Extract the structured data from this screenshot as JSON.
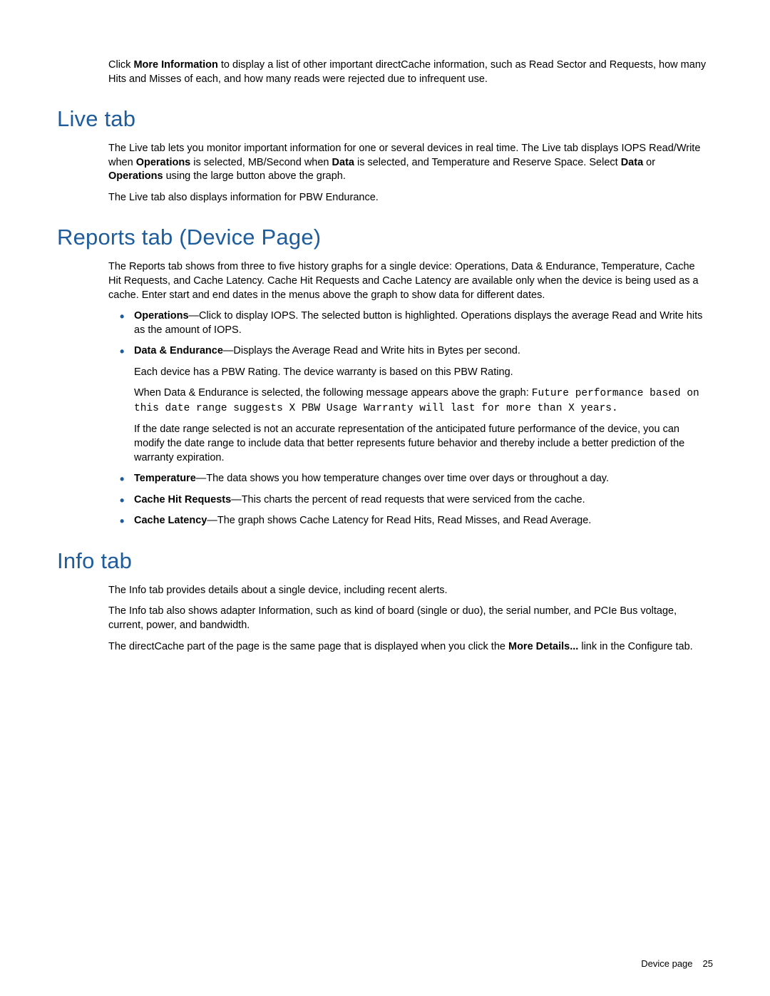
{
  "intro": {
    "p1a": "Click ",
    "p1_bold": "More Information",
    "p1b": " to display a list of other important directCache information, such as Read Sector and Requests, how many Hits and Misses of each, and how many reads were rejected due to infrequent use."
  },
  "live": {
    "heading": "Live tab",
    "p1a": "The Live tab lets you monitor important information for one or several devices in real time. The Live tab displays IOPS Read/Write when ",
    "p1_b1": "Operations",
    "p1b": " is selected, MB/Second when ",
    "p1_b2": "Data",
    "p1c": " is selected, and Temperature and Reserve Space. Select ",
    "p1_b3": "Data",
    "p1d": " or ",
    "p1_b4": "Operations",
    "p1e": " using the large button above the graph.",
    "p2": "The Live tab also displays information for PBW Endurance."
  },
  "reports": {
    "heading": "Reports tab (Device Page)",
    "p1": "The Reports tab shows from three to five history graphs for a single device: Operations, Data & Endurance, Temperature, Cache Hit Requests, and Cache Latency. Cache Hit Requests and Cache Latency are available only when the device is being used as a cache. Enter start and end dates in the menus above the graph to show data for different dates.",
    "items": [
      {
        "bold": "Operations",
        "text": "—Click to display IOPS. The selected button is highlighted. Operations displays the average Read and Write hits as the amount of IOPS."
      },
      {
        "bold": "Data & Endurance",
        "text": "—Displays the Average Read and Write hits in Bytes per second.",
        "sub1": "Each device has a PBW Rating. The device warranty is based on this PBW Rating.",
        "sub2a": "When Data & Endurance is selected, the following message appears above the graph: ",
        "sub2_mono": "Future performance based on this date range suggests X PBW Usage Warranty will last for more than X years.",
        "sub3": "If the date range selected is not an accurate representation of the anticipated future performance of the device, you can modify the date range to include data that better represents future behavior and thereby include a better prediction of the warranty expiration."
      },
      {
        "bold": "Temperature",
        "text": "—The data shows you how temperature changes over time over days or throughout a day."
      },
      {
        "bold": "Cache Hit Requests",
        "text": "—This charts the percent of read requests that were serviced from the cache."
      },
      {
        "bold": "Cache Latency",
        "text": "—The graph shows Cache Latency for Read Hits, Read Misses, and Read Average."
      }
    ]
  },
  "info": {
    "heading": "Info tab",
    "p1": "The Info tab provides details about a single device, including recent alerts.",
    "p2": "The Info tab also shows adapter Information, such as kind of board (single or duo), the serial number, and PCIe Bus voltage, current, power, and bandwidth.",
    "p3a": "The directCache part of the page is the same page that is displayed when you click the ",
    "p3_bold": "More Details...",
    "p3b": " link in the Configure tab."
  },
  "footer": {
    "label": "Device page",
    "page": "25"
  }
}
